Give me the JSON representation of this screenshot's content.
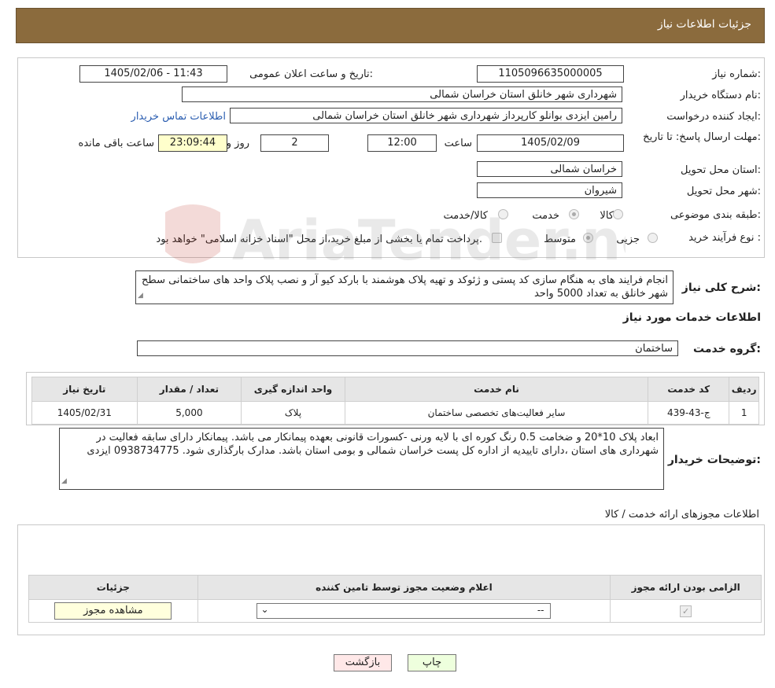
{
  "header": {
    "title": "جزئیات اطلاعات نیاز"
  },
  "form": {
    "need_number_label": "شماره نیاز:",
    "need_number": "1105096635000005",
    "announce_label": "تاریخ و ساعت اعلان عمومی:",
    "announce_value": "1405/02/06 - 11:43",
    "buyer_org_label": "نام دستگاه خریدار:",
    "buyer_org": "شهرداری شهر خانلق استان خراسان شمالی",
    "creator_label": "ایجاد کننده درخواست:",
    "creator": "رامین ایزدی بوانلو کارپرداز شهرداری شهر خانلق استان خراسان شمالی",
    "contact_link": "اطلاعات تماس خریدار",
    "deadline_label": "مهلت ارسال پاسخ: تا تاریخ:",
    "deadline_date": "1405/02/09",
    "time_label": "ساعت",
    "deadline_time": "12:00",
    "days_value": "2",
    "days_label": "روز و",
    "remaining_time": "23:09:44",
    "remaining_label": "ساعت باقی مانده",
    "province_label": "استان محل تحویل:",
    "province": "خراسان شمالی",
    "city_label": "شهر محل تحویل:",
    "city": "شیروان",
    "category_label": "طبقه بندی موضوعی:",
    "category_options": [
      "کالا",
      "خدمت",
      "کالا/خدمت"
    ],
    "process_label": "نوع فرآیند خرید :",
    "process_options": [
      "جزیی",
      "متوسط"
    ],
    "process_note": "پرداخت تمام یا بخشی از مبلغ خرید،از محل \"اسناد خزانه اسلامی\" خواهد بود."
  },
  "summary": {
    "label": "شرح کلی نیاز:",
    "text": "انجام فرایند های به هنگام سازی کد پستی و ژئوکد و تهیه پلاک هوشمند با بارکد کیو آر  و نصب پلاک واحد های ساختمانی سطح شهر خانلق به تعداد 5000 واحد"
  },
  "services": {
    "section_title": "اطلاعات خدمات مورد نیاز",
    "group_label": "گروه خدمت:",
    "group_value": "ساختمان",
    "columns": [
      "ردیف",
      "کد خدمت",
      "نام خدمت",
      "واحد اندازه گیری",
      "تعداد / مقدار",
      "تاریخ نیاز"
    ],
    "rows": [
      [
        "1",
        "ج-43-439",
        "سایر فعالیت‌های تخصصی ساختمان",
        "پلاک",
        "5,000",
        "1405/02/31"
      ]
    ]
  },
  "buyer_notes": {
    "label": "توضیحات خریدار:",
    "text": "ابعاد پلاک 10*20 و ضخامت 0.5 رنگ کوره ای با لایه ورنی -کسورات قانونی  بعهده پیمانکار می باشد. پیمانکار دارای سابقه فعالیت در شهرداری های استان ،دارای تاییدیه از اداره کل پست خراسان شمالی و بومی استان باشد. مدارک بارگذاری شود. 0938734775 ایزدی"
  },
  "permits": {
    "section_title": "اطلاعات مجوزهای ارائه خدمت / کالا",
    "columns": [
      "الزامی بودن ارائه مجوز",
      "اعلام وضعیت مجوز توسط تامین کننده",
      "جزئیات"
    ],
    "select_value": "--",
    "view_button": "مشاهده مجوز"
  },
  "footer": {
    "print_button": "چاپ",
    "back_button": "بازگشت"
  },
  "watermark": {
    "text": "AriaTender.neT"
  }
}
